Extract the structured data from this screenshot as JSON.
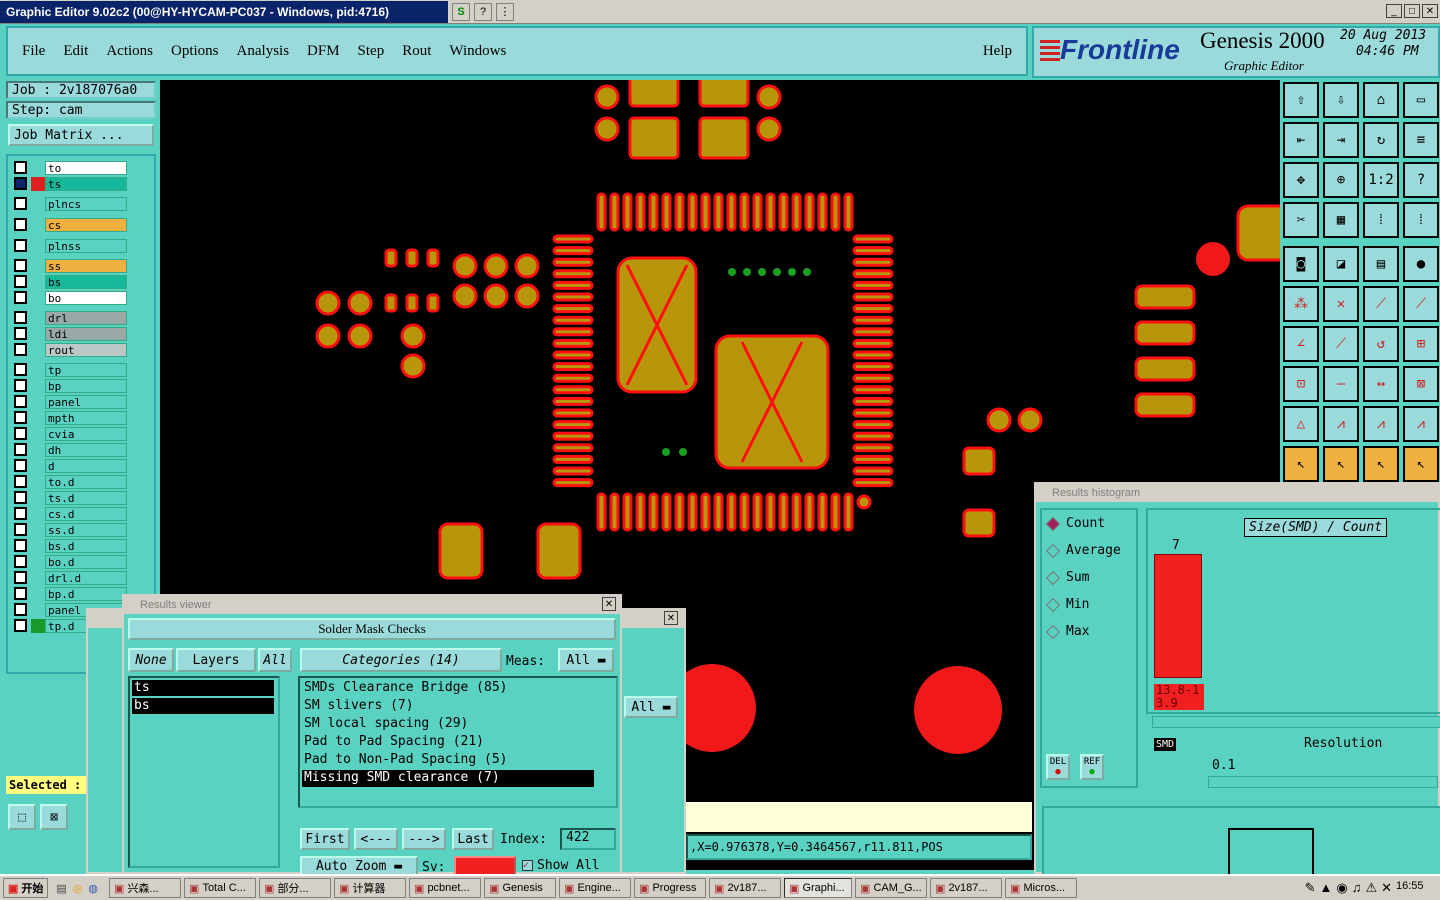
{
  "window": {
    "title": "Graphic Editor 9.02c2 (00@HY-HYCAM-PC037 - Windows, pid:4716)"
  },
  "menu": {
    "items": [
      "File",
      "Edit",
      "Actions",
      "Options",
      "Analysis",
      "DFM",
      "Step",
      "Rout",
      "Windows"
    ],
    "help": "Help"
  },
  "logo": {
    "brand": "Frontline",
    "product": "Genesis 2000",
    "subtitle": "Graphic Editor",
    "date": "20 Aug 2013",
    "time": "04:46 PM"
  },
  "job": {
    "job_line": "Job : 2v187076a0",
    "step_line": "Step: cam",
    "matrix_button": "Job Matrix ..."
  },
  "layers": [
    "to",
    "ts",
    "plncs",
    "cs",
    "plnss",
    "ss",
    "bs",
    "bo",
    "drl",
    "ldi",
    "rout",
    "tp",
    "bp",
    "panel",
    "mpth",
    "cvia",
    "dh",
    "d",
    "to.d",
    "ts.d",
    "cs.d",
    "ss.d",
    "bs.d",
    "bo.d",
    "drl.d",
    "bp.d",
    "panel",
    "tp.d"
  ],
  "selected_label": "Selected :",
  "results_viewer": {
    "title": "Results viewer",
    "heading": "Solder Mask Checks",
    "none_btn": "None",
    "layers_btn": "Layers",
    "all_btn": "All",
    "categories_btn": "Categories (14)",
    "meas_label": "Meas:",
    "meas_value": "All",
    "layer_items": [
      "ts",
      "bs"
    ],
    "categories": [
      "SMDs Clearance Bridge (85)",
      "SM slivers (7)",
      "SM local spacing (29)",
      "Pad to Pad Spacing (21)",
      "Pad to Non-Pad Spacing (5)",
      "Missing SMD clearance (7)"
    ],
    "first_btn": "First",
    "prev_btn": "<---",
    "next_btn": "--->",
    "last_btn": "Last",
    "index_label": "Index:",
    "index_value": "422",
    "zoom_value": "Auto Zoom",
    "sv_label": "Sv:",
    "show_all": "Show All",
    "bg_all": "All"
  },
  "histogram": {
    "title": "Results histogram",
    "options": [
      "Count",
      "Average",
      "Sum",
      "Min",
      "Max"
    ],
    "chart_title": "Size(SMD) / Count",
    "bar_label": "7",
    "range_label": "13.8-13.9",
    "smd_label": "SMD",
    "resolution_label": "Resolution",
    "resolution_value": "0.1",
    "del_btn": "DEL",
    "ref_btn": "REF"
  },
  "status": {
    "coords": ",X=0.976378,Y=0.3464567,r11.811,POS"
  },
  "taskbar": {
    "start": "开始",
    "tasks": [
      "兴森...",
      "Total C...",
      "部分...",
      "计算器",
      "pcbnet...",
      "Genesis",
      "Engine...",
      "Progress",
      "2v187...",
      "Graphi...",
      "CAM_G...",
      "2v187...",
      "Micros..."
    ],
    "clock": "16:55"
  },
  "colors": {
    "pad": "#b8960c",
    "outline": "#ff1010",
    "bg": "#5ad2c2",
    "panel": "#9adada"
  }
}
